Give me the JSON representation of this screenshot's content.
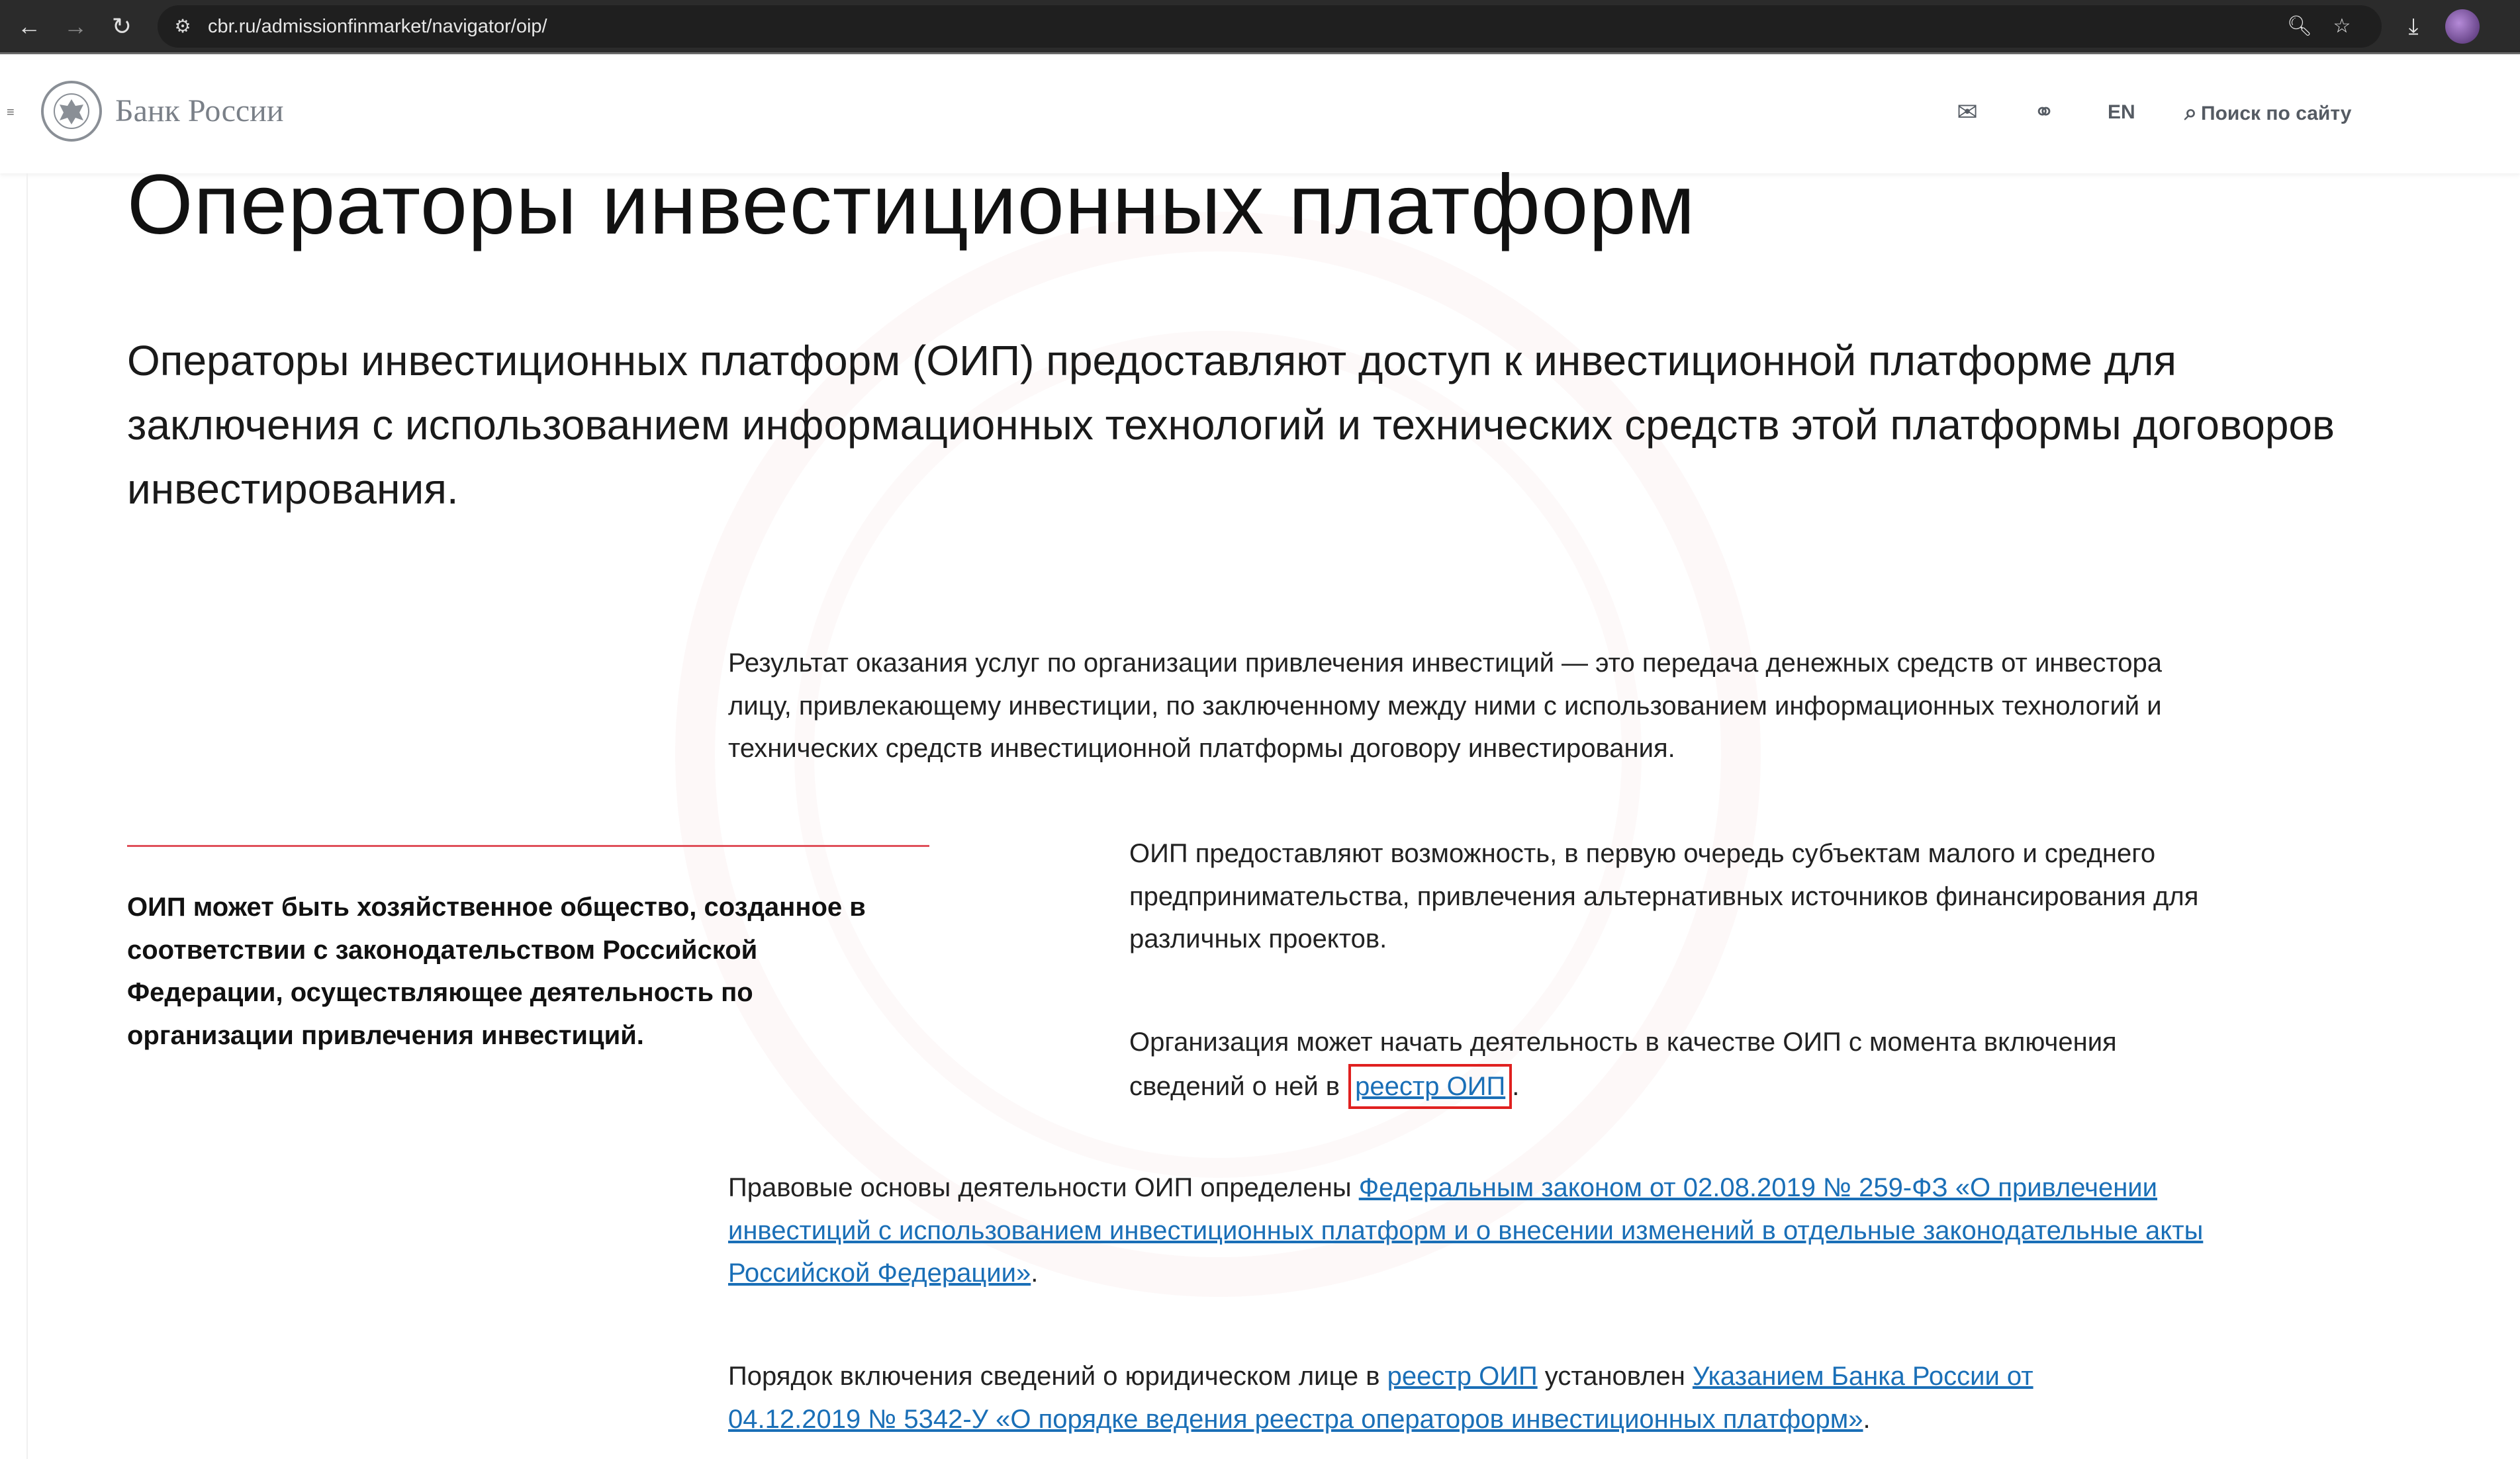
{
  "browser": {
    "url": "cbr.ru/admissionfinmarket/navigator/oip/",
    "icons": {
      "back": "arrow-left-icon",
      "forward": "arrow-right-icon",
      "reload": "reload-icon",
      "site_info": "tune-icon",
      "zoom": "zoom-icon",
      "bookmark": "star-icon",
      "download": "download-icon"
    }
  },
  "header": {
    "logo_text": "Банк России",
    "lang": "EN",
    "search_label": "Поиск по сайту"
  },
  "main": {
    "title": "Операторы инвестиционных платформ",
    "lead": "Операторы инвестиционных платформ (ОИП) предоставляют доступ к инвестиционной платформе для заключения с использованием информационных технологий и технических средств этой платформы договоров инвестирования.",
    "p1": "Результат оказания услуг по организации привлечения инвестиций — это передача денежных средств от инвестора лицу, привлекающему инвестиции, по заключенному между ними с использованием информационных технологий и технических средств инвестиционной платформы договору инвестирования.",
    "callout": "ОИП может быть хозяйственное общество, созданное в соответствии с законодательством Российской Федерации, осуществляющее деятельность по организации привлечения инвестиций.",
    "p2": "ОИП предоставляют возможность, в первую очередь субъектам малого и среднего предпринимательства, привлечения альтернативных источников финансирования для различных проектов.",
    "p3_before": "Организация может начать деятельность в качестве ОИП с момента включения сведений о ней в ",
    "p3_link": "реестр ОИП",
    "p3_after": ".",
    "p4_before": "Правовые основы деятельности ОИП определены ",
    "p4_link": "Федеральным законом от 02.08.2019 № 259-ФЗ «О привлечении инвестиций с использованием инвестиционных платформ и о внесении изменений в отдельные законодательные акты Российской Федерации»",
    "p4_after": ".",
    "p5_before": "Порядок включения сведений о юридическом лице в ",
    "p5_link1": "реестр ОИП",
    "p5_mid": " установлен ",
    "p5_link2": "Указанием Банка России от 04.12.2019 № 5342-У «О порядке ведения реестра операторов инвестиционных платформ»",
    "p5_after": "."
  },
  "colors": {
    "link": "#1a6fb7",
    "highlight": "#e0201f",
    "accent_rule": "#e0505a"
  }
}
